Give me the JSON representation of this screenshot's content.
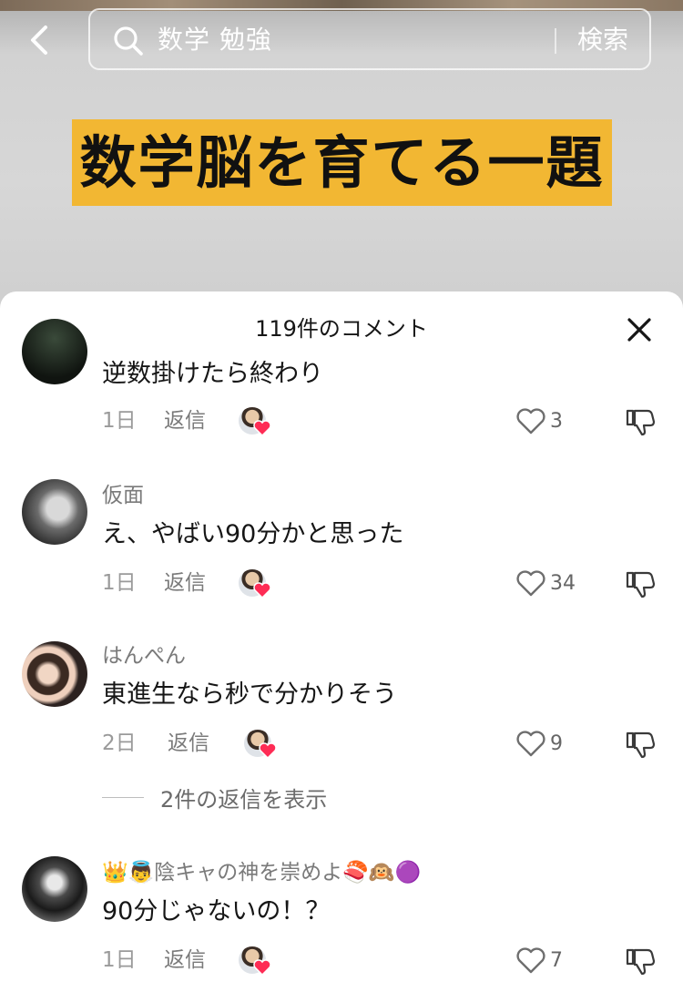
{
  "search": {
    "query": "数学 勉強",
    "button_label": "検索"
  },
  "video": {
    "banner_text": "数学脳を育てる一題"
  },
  "comments_sheet": {
    "title": "119件のコメント",
    "comments": [
      {
        "username": "",
        "text": "逆数掛けたら終わり",
        "date": "1日",
        "reply_label": "返信",
        "likes": "3"
      },
      {
        "username": "仮面",
        "text": "え、やばい90分かと思った",
        "date": "1日",
        "reply_label": "返信",
        "likes": "34"
      },
      {
        "username": "はんぺん",
        "text": "東進生なら秒で分かりそう",
        "date": "2日",
        "reply_label": "返信",
        "likes": "9",
        "view_replies": "2件の返信を表示"
      },
      {
        "username": "👑👼陰キャの神を崇めよ🍣🙉🟣",
        "text": "90分じゃないの！？",
        "date": "1日",
        "reply_label": "返信",
        "likes": "7"
      }
    ]
  },
  "icons": [
    "back-icon",
    "search-icon",
    "close-icon",
    "heart-outline-icon",
    "dislike-icon",
    "creator-liked-heart-icon"
  ],
  "colors": {
    "banner": "#f2b733",
    "liked_heart": "#fe2c55"
  }
}
